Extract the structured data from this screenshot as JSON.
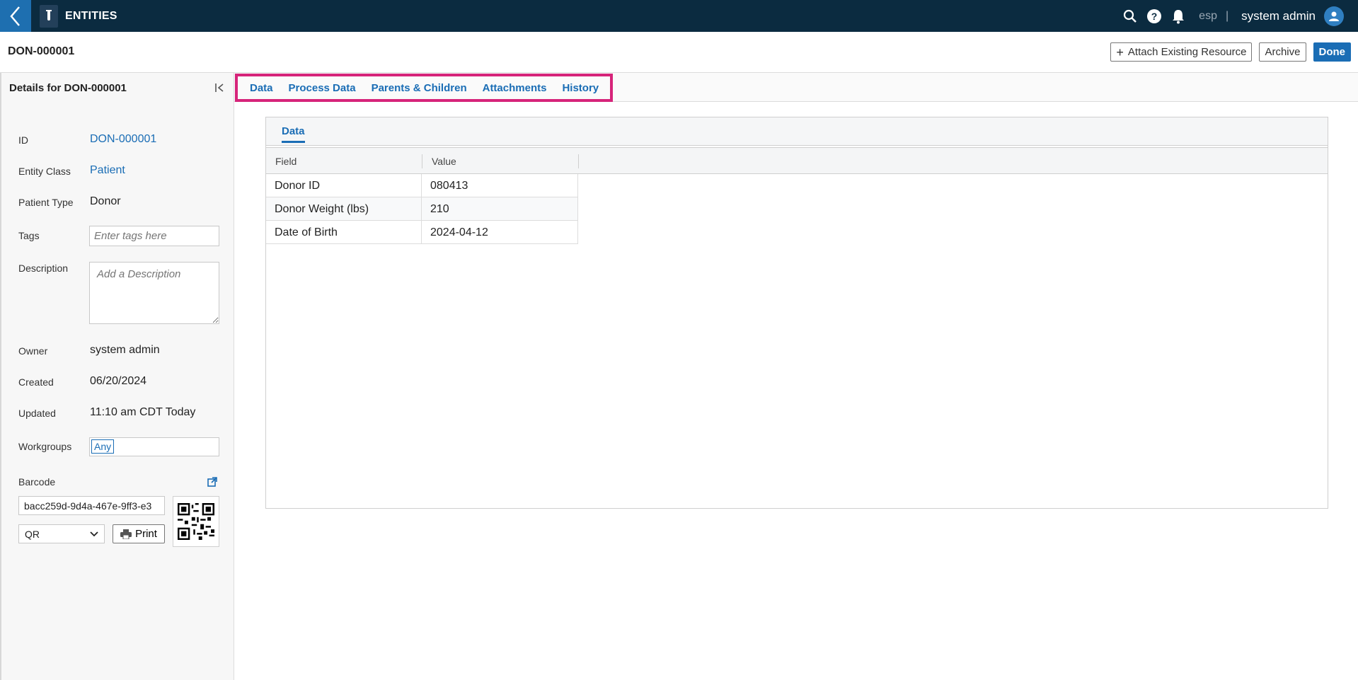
{
  "app": {
    "title": "ENTITIES"
  },
  "topbar": {
    "env": "esp",
    "separator": "|",
    "user": "system admin"
  },
  "header": {
    "title": "DON-000001"
  },
  "actions": {
    "attach_label": "Attach Existing Resource",
    "archive_label": "Archive",
    "done_label": "Done"
  },
  "details": {
    "title": "Details for DON-000001",
    "id_label": "ID",
    "id_value": "DON-000001",
    "entity_class_label": "Entity Class",
    "entity_class_value": "Patient",
    "patient_type_label": "Patient Type",
    "patient_type_value": "Donor",
    "tags_label": "Tags",
    "tags_placeholder": "Enter tags here",
    "description_label": "Description",
    "description_placeholder": "Add a Description",
    "owner_label": "Owner",
    "owner_value": "system admin",
    "created_label": "Created",
    "created_value": "06/20/2024",
    "updated_label": "Updated",
    "updated_value": "11:10 am CDT Today",
    "workgroups_label": "Workgroups",
    "workgroup_chip": "Any",
    "barcode_label": "Barcode",
    "barcode_value": "bacc259d-9d4a-467e-9ff3-e3",
    "barcode_type": "QR",
    "print_label": "Print"
  },
  "tabs": [
    {
      "label": "Data"
    },
    {
      "label": "Process Data"
    },
    {
      "label": "Parents & Children"
    },
    {
      "label": "Attachments"
    },
    {
      "label": "History"
    }
  ],
  "data_card": {
    "tab_label": "Data",
    "columns": [
      "Field",
      "Value"
    ],
    "rows": [
      {
        "field": "Donor ID",
        "value": "080413"
      },
      {
        "field": "Donor Weight (lbs)",
        "value": "210"
      },
      {
        "field": "Date of Birth",
        "value": "2024-04-12"
      }
    ]
  },
  "colors": {
    "navbar": "#0b2b40",
    "accent": "#1a6db5",
    "highlight": "#d6247a"
  }
}
